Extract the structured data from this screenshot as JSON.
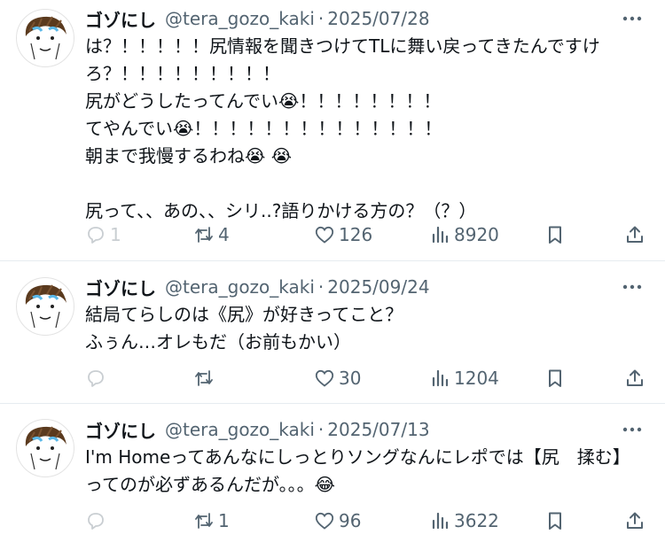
{
  "tweets": [
    {
      "author": "ゴゾにし",
      "handle": "@tera_gozo_kaki",
      "separator": "·",
      "date": "2025/07/28",
      "text": "は？！！！！！尻情報を聞きつけてTLに舞い戻ってきたんですけろ？！！！！！！！！！\n尻がどうしたってんでい😭！！！！！！！！\nてやんでい😭！！！！！！！！！！！！！！\n朝まで我慢するわね😭 😭\n\n尻って、、あの、、シリ..?語りかける方の？（？）",
      "reply_count": "1",
      "retweet_count": "4",
      "like_count": "126",
      "view_count": "8920"
    },
    {
      "author": "ゴゾにし",
      "handle": "@tera_gozo_kaki",
      "separator": "·",
      "date": "2025/09/24",
      "text": "結局てらしのは《尻》が好きってこと？\nふぅん…オレもだ（お前もかい）",
      "reply_count": "",
      "retweet_count": "",
      "like_count": "30",
      "view_count": "1204"
    },
    {
      "author": "ゴゾにし",
      "handle": "@tera_gozo_kaki",
      "separator": "·",
      "date": "2025/07/13",
      "text": "I'm Homeってあんなにしっとりソングなんにレポでは【尻　揉む】ってのが必ずあるんだが。。。😂",
      "reply_count": "",
      "retweet_count": "1",
      "like_count": "96",
      "view_count": "3622"
    }
  ],
  "icons": {
    "avatar": "hand-drawn-face-avatar",
    "more": "more-dots-icon",
    "reply": "reply-icon",
    "retweet": "retweet-icon",
    "like": "heart-icon",
    "views": "views-bar-icon",
    "bookmark": "bookmark-icon",
    "share": "share-icon"
  },
  "colors": {
    "text": "#0f1419",
    "secondary": "#536471",
    "divider": "#e6ecf0"
  }
}
